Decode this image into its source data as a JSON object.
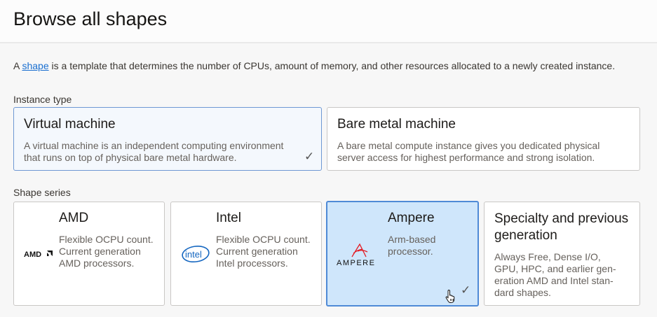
{
  "header": {
    "title": "Browse all shapes"
  },
  "description": {
    "prefix": "A ",
    "link": "shape",
    "suffix": " is a template that determines the number of CPUs, amount of memory, and other resources allocated to a newly created instance."
  },
  "instance_type": {
    "label": "Instance type",
    "options": [
      {
        "title": "Virtual machine",
        "text": "A virtual machine is an independent computing environment that runs on top of physical bare metal hardware.",
        "selected": true
      },
      {
        "title": "Bare metal machine",
        "text": "A bare metal compute instance gives you dedicated physical server access for highest performance and strong isolation.",
        "selected": false
      }
    ]
  },
  "shape_series": {
    "label": "Shape series",
    "options": [
      {
        "title": "AMD",
        "text": "Flexible OCPU count. Current generation AMD processors.",
        "logo": "AMD",
        "selected": false
      },
      {
        "title": "Intel",
        "text": "Flexible OCPU count. Current generation Intel processors.",
        "logo": "intel",
        "selected": false
      },
      {
        "title": "Ampere",
        "text": "Arm-based processor.",
        "logo": "AMPERE",
        "selected": true
      },
      {
        "title": "Specialty and previous generation",
        "text": "Always Free, Dense I/O, GPU, HPC, and earlier gen-eration AMD and Intel stan-dard shapes.",
        "selected": false
      }
    ]
  },
  "colors": {
    "accent": "#1a6fd0",
    "selected_bg": "#cfe6fb",
    "selected_border": "#4f8ad6"
  },
  "icons": {
    "check": "checkmark-icon",
    "cursor": "hand-pointer-icon"
  }
}
